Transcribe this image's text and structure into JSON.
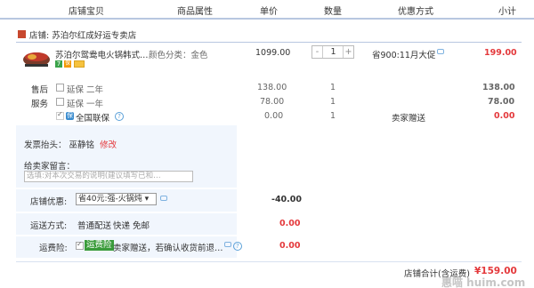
{
  "header": {
    "col_product": "店铺宝贝",
    "col_attr": "商品属性",
    "col_price": "单价",
    "col_qty": "数量",
    "col_discount": "优惠方式",
    "col_subtotal": "小计"
  },
  "shop": {
    "prefix": "店铺:",
    "name": "苏泊尔红成好运专卖店"
  },
  "item": {
    "title": "苏泊尔鸳鸯电火锅韩式…",
    "badges": [
      "7",
      "保"
    ],
    "attribute": "颜色分类：金色",
    "unit_price": "1099.00",
    "qty_minus": "-",
    "qty_value": "1",
    "qty_plus": "+",
    "discount": "省900:11月大促",
    "subtotal": "199.00"
  },
  "services": {
    "after_sale_label": "售后",
    "service_label": "服务",
    "rows": [
      {
        "label": "延保 二年",
        "price": "138.00",
        "qty": "1",
        "method": "",
        "subtotal": "138.00"
      },
      {
        "label": "延保 一年",
        "price": "78.00",
        "qty": "1",
        "method": "",
        "subtotal": "78.00"
      },
      {
        "label": "全国联保",
        "price": "0.00",
        "qty": "1",
        "method": "卖家赠送",
        "subtotal": "0.00"
      }
    ]
  },
  "invoice": {
    "label": "发票抬头：",
    "value": "巫静铭",
    "edit": "修改"
  },
  "message": {
    "label": "给卖家留言：",
    "placeholder": "选填:对本次交易的说明(建议填写已和…"
  },
  "shop_discount": {
    "label": "店铺优惠:",
    "selected": "省40元:强-火锅炖 ▾",
    "amount": "-40.00"
  },
  "shipping": {
    "label": "运送方式:",
    "option1": "普通配送",
    "option2": "快递 免邮",
    "amount": "0.00"
  },
  "insurance": {
    "label": "运费险:",
    "tag": "运费险",
    "desc": "卖家赠送，若确认收货前退…",
    "amount": "0.00"
  },
  "total": {
    "label": "店铺合计(含运费)",
    "value": "¥159.00"
  },
  "watermark": {
    "text": "惠喵 huim.com"
  },
  "colors": {
    "accent_red": "#e4393c",
    "link_orange": "#e4393c",
    "panel_blue": "#f1f6fd",
    "header_border": "#b8c7e0"
  }
}
